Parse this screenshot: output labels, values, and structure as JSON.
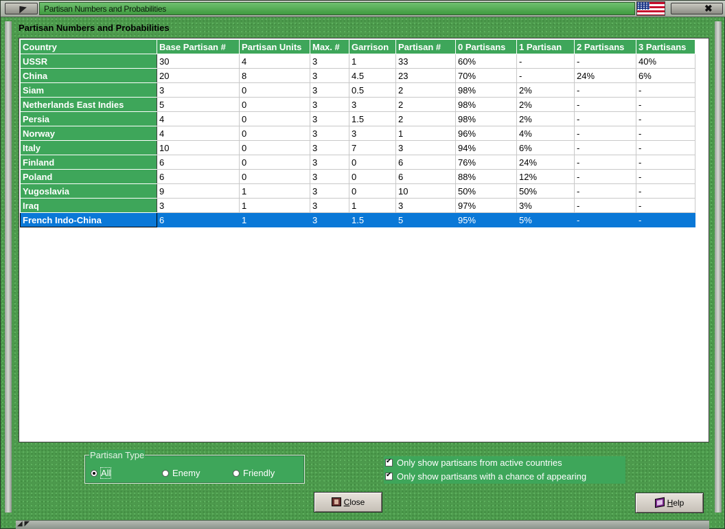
{
  "window": {
    "title": "Partisan Numbers and Probabilities",
    "close_symbol": "✖"
  },
  "heading": "Partisan Numbers and Probabilities",
  "table": {
    "columns": [
      "Country",
      "Base Partisan #",
      "Partisan Units",
      "Max. #",
      "Garrison",
      "Partisan #",
      "0 Partisans",
      "1 Partisan",
      "2 Partisans",
      "3 Partisans"
    ],
    "rows": [
      [
        "USSR",
        "30",
        "4",
        "3",
        "1",
        "33",
        "60%",
        "-",
        "-",
        "40%"
      ],
      [
        "China",
        "20",
        "8",
        "3",
        "4.5",
        "23",
        "70%",
        "-",
        "24%",
        "6%"
      ],
      [
        "Siam",
        "3",
        "0",
        "3",
        "0.5",
        "2",
        "98%",
        "2%",
        "-",
        "-"
      ],
      [
        "Netherlands East Indies",
        "5",
        "0",
        "3",
        "3",
        "2",
        "98%",
        "2%",
        "-",
        "-"
      ],
      [
        "Persia",
        "4",
        "0",
        "3",
        "1.5",
        "2",
        "98%",
        "2%",
        "-",
        "-"
      ],
      [
        "Norway",
        "4",
        "0",
        "3",
        "3",
        "1",
        "96%",
        "4%",
        "-",
        "-"
      ],
      [
        "Italy",
        "10",
        "0",
        "3",
        "7",
        "3",
        "94%",
        "6%",
        "-",
        "-"
      ],
      [
        "Finland",
        "6",
        "0",
        "3",
        "0",
        "6",
        "76%",
        "24%",
        "-",
        "-"
      ],
      [
        "Poland",
        "6",
        "0",
        "3",
        "0",
        "6",
        "88%",
        "12%",
        "-",
        "-"
      ],
      [
        "Yugoslavia",
        "9",
        "1",
        "3",
        "0",
        "10",
        "50%",
        "50%",
        "-",
        "-"
      ],
      [
        "Iraq",
        "3",
        "1",
        "3",
        "1",
        "3",
        "97%",
        "3%",
        "-",
        "-"
      ],
      [
        "French Indo-China",
        "6",
        "1",
        "3",
        "1.5",
        "5",
        "95%",
        "5%",
        "-",
        "-"
      ]
    ],
    "selected_row_index": 11
  },
  "partisan_type": {
    "legend": "Partisan Type",
    "options": [
      {
        "label": "All",
        "selected": true
      },
      {
        "label": "Enemy",
        "selected": false
      },
      {
        "label": "Friendly",
        "selected": false
      }
    ]
  },
  "filters": {
    "active_countries": {
      "label": "Only show partisans from active countries",
      "checked": true
    },
    "chance_of_appearing": {
      "label": "Only show partisans with a chance of appearing",
      "checked": true
    }
  },
  "buttons": {
    "close_label_underlined": "C",
    "close_label_rest": "lose",
    "help_label_underlined": "H",
    "help_label_rest": "elp"
  },
  "colors": {
    "header_green": "#3ea65a",
    "selection_blue": "#0a78d7",
    "window_green": "#4d9a4d"
  }
}
